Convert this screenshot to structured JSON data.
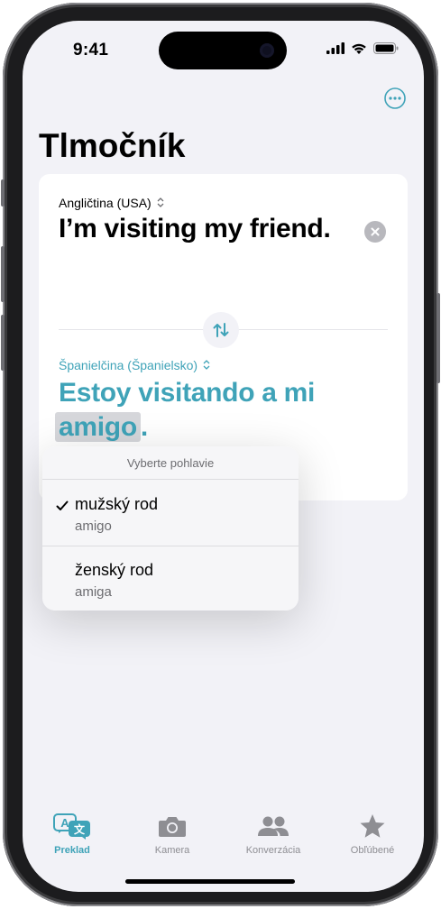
{
  "status_bar": {
    "time": "9:41"
  },
  "header": {
    "title": "Tlmočník"
  },
  "source": {
    "language": "Angličtina (USA)",
    "text": "I’m visiting my friend."
  },
  "target": {
    "language": "Španielčina (Španielsko)",
    "text_before": "Estoy visitando a mi ",
    "highlighted_word": "amigo",
    "text_after": "."
  },
  "gender_menu": {
    "header": "Vyberte pohlavie",
    "options": [
      {
        "label": "mužský rod",
        "value": "amigo",
        "selected": true
      },
      {
        "label": "ženský rod",
        "value": "amiga",
        "selected": false
      }
    ]
  },
  "tabbar": {
    "items": [
      {
        "label": "Preklad",
        "icon": "translate-icon",
        "active": true
      },
      {
        "label": "Kamera",
        "icon": "camera-icon",
        "active": false
      },
      {
        "label": "Konverzácia",
        "icon": "people-icon",
        "active": false
      },
      {
        "label": "Obľúbené",
        "icon": "star-icon",
        "active": false
      }
    ]
  },
  "colors": {
    "accent": "#3fa3b8",
    "inactive": "#8e8e93",
    "background": "#f2f2f7"
  }
}
